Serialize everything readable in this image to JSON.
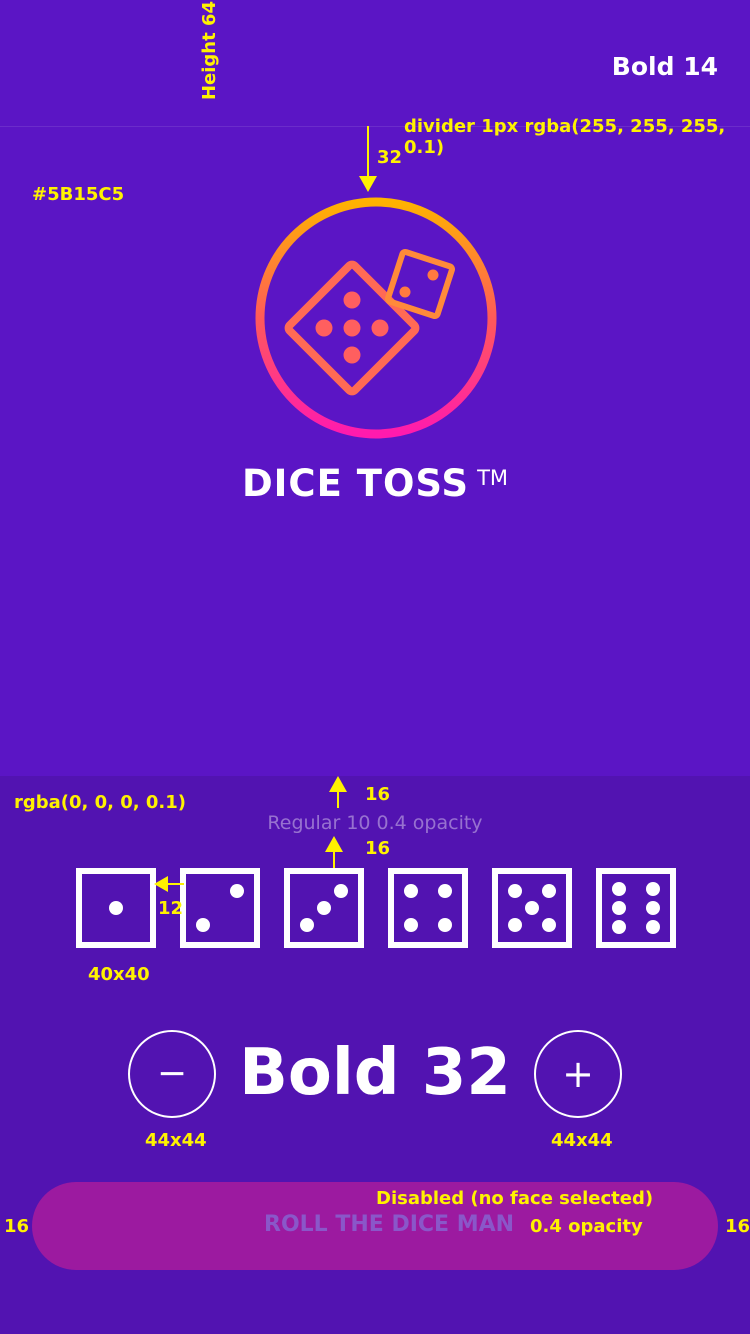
{
  "header": {
    "spec_height": "Height 64",
    "spec_font": "Bold 14",
    "spec_divider": "divider 1px rgba(255, 255, 255, 0.1)"
  },
  "logo": {
    "spec_gap": "32",
    "spec_bg_color": "#5B15C5",
    "title": "DICE TOSS",
    "trademark": "TM"
  },
  "panel": {
    "spec_bg": "rgba(0, 0, 0, 0.1)",
    "spec_gap_top": "16",
    "hint_text": "Regular 10 0.4 opacity",
    "spec_gap_bottom": "16",
    "spec_die_gap": "12",
    "spec_die_size": "40x40",
    "dice_faces": [
      1,
      2,
      3,
      4,
      5,
      6
    ]
  },
  "stepper": {
    "minus_symbol": "−",
    "plus_symbol": "+",
    "value": "Bold 32",
    "spec_minus_size": "44x44",
    "spec_plus_size": "44x44"
  },
  "roll": {
    "label": "ROLL THE DICE MAN",
    "spec_disabled": "Disabled (no face selected)",
    "spec_opacity": "0.4  opacity",
    "spec_margin_left": "16",
    "spec_margin_right": "16"
  },
  "colors": {
    "background": "#5B15C5",
    "panel": "#5213B1",
    "annotation": "#FFF200",
    "button_disabled": "#9C1AA0"
  }
}
